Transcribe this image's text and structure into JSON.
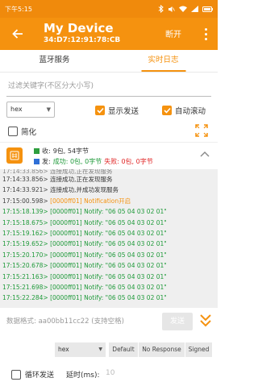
{
  "status_bar": {
    "time": "下午5:15"
  },
  "app_bar": {
    "title": "My Device",
    "address": "34:D7:12:91:78:CB",
    "disconnect_label": "断开"
  },
  "tabs": [
    {
      "label": "蓝牙服务"
    },
    {
      "label": "实时日志"
    }
  ],
  "active_tab": "实时日志",
  "filter": {
    "placeholder": "过滤关键字(不区分大小写)"
  },
  "encoding": {
    "selected": "hex"
  },
  "options": {
    "show_send": {
      "label": "显示发送",
      "checked": true
    },
    "auto_scroll": {
      "label": "自动滚动",
      "checked": true
    },
    "simplify": {
      "label": "简化",
      "checked": false
    }
  },
  "stats": {
    "recv_prefix": "收:",
    "recv_value": "9包, 54字节",
    "send_prefix": "发:",
    "send_success": "成功: 0包, 0字节",
    "send_fail": "失败: 0包, 0字节"
  },
  "log_lines": [
    {
      "ts": "17:14:33.856>",
      "msg": "连接成功,正在发现服务",
      "kind": "plain"
    },
    {
      "ts": "17:14:33.856>",
      "msg": "连接成功,正在发现服务",
      "kind": "plain"
    },
    {
      "ts": "17:14:33.921>",
      "msg": "连接成功,并成功发现服务",
      "kind": "plain"
    },
    {
      "ts": "17:15:00.598>",
      "msg": "[0000ff01] Notification开启",
      "kind": "o"
    },
    {
      "ts": "17:15:18.139>",
      "msg": "[0000ff01] Notify: \"06 05 04 03 02 01\"",
      "kind": "g"
    },
    {
      "ts": "17:15:18.675>",
      "msg": "[0000ff01] Notify: \"06 05 04 03 02 01\"",
      "kind": "g"
    },
    {
      "ts": "17:15:19.162>",
      "msg": "[0000ff01] Notify: \"06 05 04 03 02 01\"",
      "kind": "g"
    },
    {
      "ts": "17:15:19.652>",
      "msg": "[0000ff01] Notify: \"06 05 04 03 02 01\"",
      "kind": "g"
    },
    {
      "ts": "17:15:20.170>",
      "msg": "[0000ff01] Notify: \"06 05 04 03 02 01\"",
      "kind": "g"
    },
    {
      "ts": "17:15:20.678>",
      "msg": "[0000ff01] Notify: \"06 05 04 03 02 01\"",
      "kind": "g"
    },
    {
      "ts": "17:15:21.163>",
      "msg": "[0000ff01] Notify: \"06 05 04 03 02 01\"",
      "kind": "g"
    },
    {
      "ts": "17:15:21.698>",
      "msg": "[0000ff01] Notify: \"06 05 04 03 02 01\"",
      "kind": "g"
    },
    {
      "ts": "17:15:22.284>",
      "msg": "[0000ff01] Notify: \"06 05 04 03 02 01\"",
      "kind": "g"
    }
  ],
  "send": {
    "placeholder": "数据格式: aa00bb11cc22 (支持空格)",
    "send_label": "发送",
    "encoding": "hex",
    "chips": [
      "Default",
      "No Response",
      "Signed"
    ],
    "loop_label": "循环发送",
    "loop_checked": false,
    "delay_label": "延时(ms):",
    "delay_value": "10"
  },
  "colors": {
    "accent": "#f5920f",
    "notify_green": "#1f9a3a",
    "recv_square": "#2e9e3e",
    "send_square": "#2f6fd6",
    "fail_red": "#e02424"
  }
}
